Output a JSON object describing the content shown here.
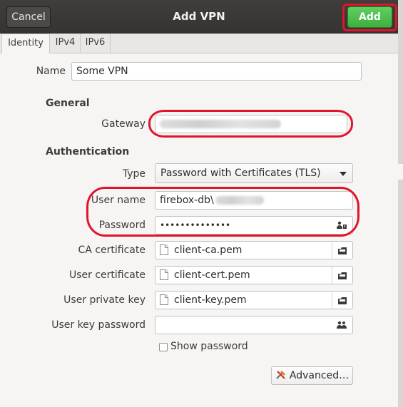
{
  "dialog": {
    "title": "Add VPN",
    "cancel_label": "Cancel",
    "add_label": "Add"
  },
  "tabs": [
    {
      "label": "Identity",
      "active": true
    },
    {
      "label": "IPv4",
      "active": false
    },
    {
      "label": "IPv6",
      "active": false
    }
  ],
  "identity": {
    "name_label": "Name",
    "name_value": "Some VPN"
  },
  "general": {
    "heading": "General",
    "gateway_label": "Gateway"
  },
  "authentication": {
    "heading": "Authentication",
    "type_label": "Type",
    "type_value": "Password with Certificates (TLS)",
    "username_label": "User name",
    "username_value": "firebox-db\\",
    "password_label": "Password",
    "password_value": "••••••••••••••",
    "ca_label": "CA certificate",
    "ca_value": "client-ca.pem",
    "user_cert_label": "User certificate",
    "user_cert_value": "client-cert.pem",
    "private_key_label": "User private key",
    "private_key_value": "client-key.pem",
    "key_password_label": "User key password",
    "show_password_label": "Show password",
    "show_password_checked": false,
    "advanced_label": "Advanced…"
  },
  "colors": {
    "highlight": "#e0142a",
    "add_button": "#4fbf4f",
    "headerbar": "#3a3937"
  }
}
